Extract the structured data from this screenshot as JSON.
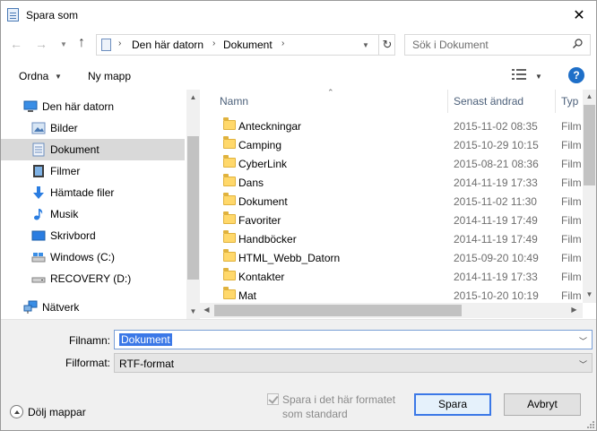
{
  "window": {
    "title": "Spara som"
  },
  "address": {
    "crumbs": [
      "Den här datorn",
      "Dokument"
    ]
  },
  "search": {
    "placeholder": "Sök i Dokument"
  },
  "toolbar": {
    "organize": "Ordna",
    "new_folder": "Ny mapp"
  },
  "sidebar": {
    "items": [
      {
        "label": "Den här datorn",
        "icon": "computer-icon",
        "selected": false
      },
      {
        "label": "Bilder",
        "icon": "pictures-icon",
        "selected": false
      },
      {
        "label": "Dokument",
        "icon": "documents-icon",
        "selected": true
      },
      {
        "label": "Filmer",
        "icon": "videos-icon",
        "selected": false
      },
      {
        "label": "Hämtade filer",
        "icon": "downloads-icon",
        "selected": false
      },
      {
        "label": "Musik",
        "icon": "music-icon",
        "selected": false
      },
      {
        "label": "Skrivbord",
        "icon": "desktop-icon",
        "selected": false
      },
      {
        "label": "Windows (C:)",
        "icon": "drive-icon",
        "selected": false
      },
      {
        "label": "RECOVERY (D:)",
        "icon": "drive-icon",
        "selected": false
      },
      {
        "label": "Nätverk",
        "icon": "network-icon",
        "selected": false
      }
    ]
  },
  "filelist": {
    "columns": {
      "name": "Namn",
      "date": "Senast ändrad",
      "type": "Typ"
    },
    "rows": [
      {
        "name": "Anteckningar",
        "date": "2015-11-02 08:35",
        "type": "Filmapp"
      },
      {
        "name": "Camping",
        "date": "2015-10-29 10:15",
        "type": "Filmapp"
      },
      {
        "name": "CyberLink",
        "date": "2015-08-21 08:36",
        "type": "Filmapp"
      },
      {
        "name": "Dans",
        "date": "2014-11-19 17:33",
        "type": "Filmapp"
      },
      {
        "name": "Dokument",
        "date": "2015-11-02 11:30",
        "type": "Filmapp"
      },
      {
        "name": "Favoriter",
        "date": "2014-11-19 17:49",
        "type": "Filmapp"
      },
      {
        "name": "Handböcker",
        "date": "2014-11-19 17:49",
        "type": "Filmapp"
      },
      {
        "name": "HTML_Webb_Datorn",
        "date": "2015-09-20 10:49",
        "type": "Filmapp"
      },
      {
        "name": "Kontakter",
        "date": "2014-11-19 17:33",
        "type": "Filmapp"
      },
      {
        "name": "Mat",
        "date": "2015-10-20 10:19",
        "type": "Filmapp"
      }
    ]
  },
  "form": {
    "filename_label": "Filnamn:",
    "filename_value": "Dokument",
    "format_label": "Filformat:",
    "format_value": "RTF-format",
    "checkbox_label_1": "Spara i det här formatet",
    "checkbox_label_2": "som standard",
    "save_label": "Spara",
    "cancel_label": "Avbryt",
    "hide_folders_label": "Dölj mappar"
  }
}
